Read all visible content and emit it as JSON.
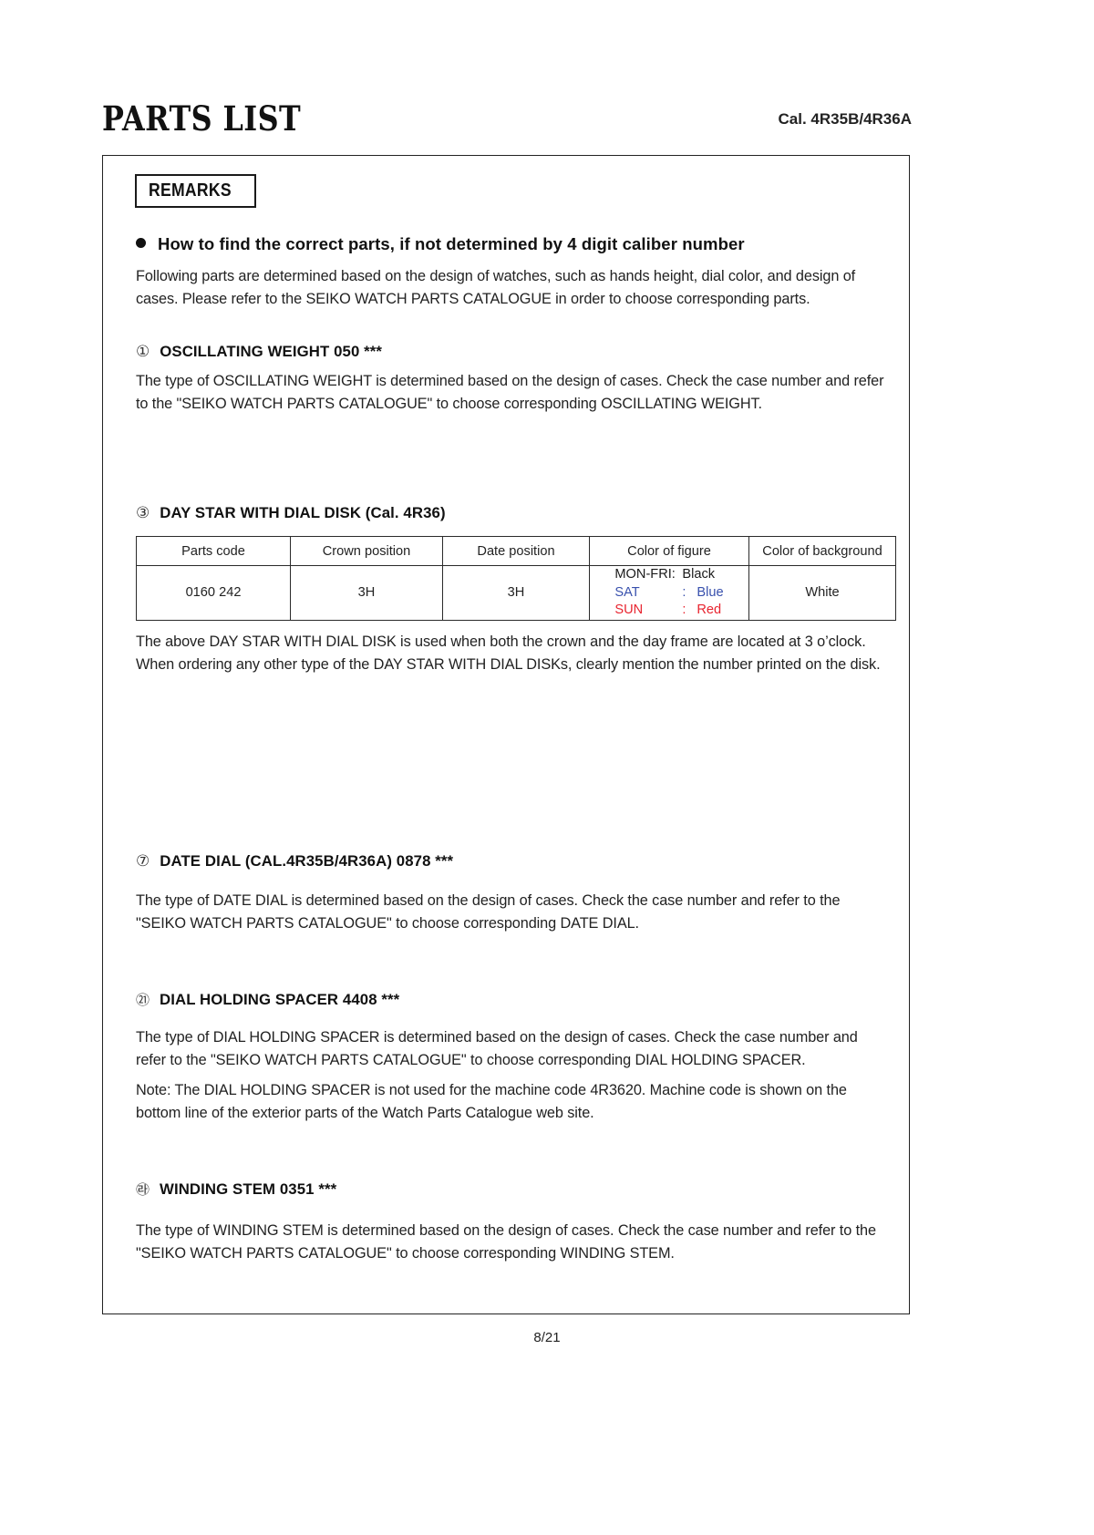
{
  "header": {
    "title": "PARTS LIST",
    "caliber": "Cal. 4R35B/4R36A"
  },
  "remarks": {
    "box_label": "REMARKS",
    "bullet_heading": "How to find the correct parts, if not determined by 4 digit caliber number",
    "intro_paragraph": "Following parts are determined based on the design of watches, such as hands height, dial color, and design of cases.  Please refer to the SEIKO WATCH PARTS CATALOGUE in order to choose corresponding parts."
  },
  "sections": [
    {
      "number": "①",
      "heading": "OSCILLATING WEIGHT  050 ***",
      "paragraph": "The type of OSCILLATING WEIGHT is determined based on the design of cases. Check the case number and refer to the \"SEIKO WATCH PARTS CATALOGUE\" to choose corresponding OSCILLATING WEIGHT."
    },
    {
      "number": "③",
      "heading": "DAY STAR WITH DIAL DISK (Cal. 4R36)",
      "paragraph": "The above DAY STAR WITH DIAL DISK is used when both the crown and the day frame are located at 3 o’clock. When ordering any other type of the DAY STAR WITH DIAL DISKs, clearly mention the number printed on the disk."
    },
    {
      "number": "⑦",
      "heading": "DATE DIAL (CAL.4R35B/4R36A) 0878 ***",
      "paragraph": "The type of DATE DIAL is determined based on the design of cases. Check the case number and refer to the \"SEIKO WATCH PARTS CATALOGUE\" to choose corresponding DATE DIAL."
    },
    {
      "number": "㉑",
      "heading": "DIAL HOLDING SPACER 4408 ***",
      "paragraph": "The type of DIAL HOLDING SPACER is determined based on the design of cases. Check the case number and refer to the \"SEIKO WATCH PARTS CATALOGUE\" to choose corresponding DIAL HOLDING SPACER.",
      "note": "Note: The DIAL HOLDING SPACER is not used for the machine code 4R3620. Machine code is shown on the bottom line of the exterior parts of the Watch Parts Catalogue web site."
    },
    {
      "number": "㉱",
      "heading": "WINDING STEM  0351 ***",
      "paragraph": "The type of WINDING STEM is determined based on the design of cases. Check the case number and refer to the \"SEIKO WATCH PARTS CATALOGUE\" to choose corresponding WINDING STEM."
    }
  ],
  "table": {
    "headers": [
      "Parts code",
      "Crown position",
      "Date position",
      "Color of figure",
      "Color of background"
    ],
    "row": {
      "parts_code": "0160 242",
      "crown_position": "3H",
      "date_position": "3H",
      "color_of_figure": [
        {
          "day": "MON-FRI:",
          "sep": "",
          "value": "Black",
          "color": "#1a1a1a"
        },
        {
          "day": "SAT",
          "sep": ":",
          "value": "Blue",
          "color": "#3850ad"
        },
        {
          "day": "SUN",
          "sep": ":",
          "value": "Red",
          "color": "#e8242f"
        }
      ],
      "color_of_background": "White"
    }
  },
  "footer": {
    "page_number": "8/21"
  }
}
